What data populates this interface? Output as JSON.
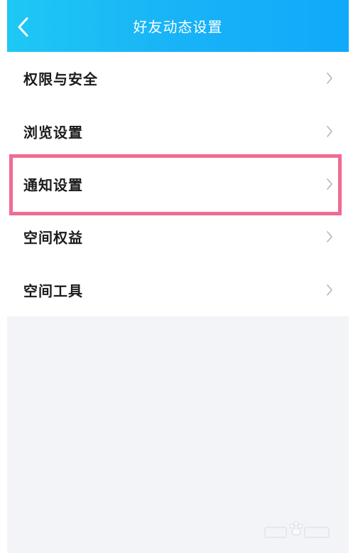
{
  "header": {
    "title": "好友动态设置",
    "back_icon": "chevron-left-icon"
  },
  "menu": {
    "items": [
      {
        "label": "权限与安全",
        "icon": "chevron-right-icon"
      },
      {
        "label": "浏览设置",
        "icon": "chevron-right-icon"
      },
      {
        "label": "通知设置",
        "icon": "chevron-right-icon",
        "highlighted": true
      },
      {
        "label": "空间权益",
        "icon": "chevron-right-icon"
      },
      {
        "label": "空间工具",
        "icon": "chevron-right-icon"
      }
    ]
  },
  "colors": {
    "header_start": "#1ec8f4",
    "header_end": "#10a9fb",
    "highlight_border": "#f06b92",
    "page_background": "#f3f4f8"
  }
}
